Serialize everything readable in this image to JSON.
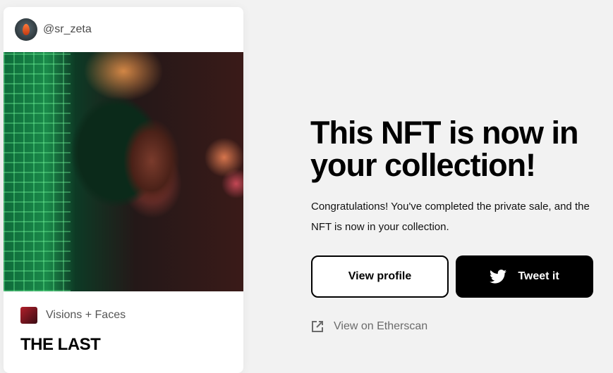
{
  "card": {
    "username": "@sr_zeta",
    "collection": "Visions + Faces",
    "title": "THE LAST"
  },
  "main": {
    "headline": "This NFT is now in your collection!",
    "description": "Congratulations! You've completed the private sale, and the NFT is now in your collection.",
    "view_profile_label": "View profile",
    "tweet_label": "Tweet it",
    "etherscan_label": "View on Etherscan"
  },
  "colors": {
    "background": "#f2f2f2",
    "primary_button": "#000000",
    "link_gray": "#6b6b6b"
  },
  "icons": [
    "avatar",
    "twitter-icon",
    "external-link-icon",
    "collection-thumbnail"
  ]
}
